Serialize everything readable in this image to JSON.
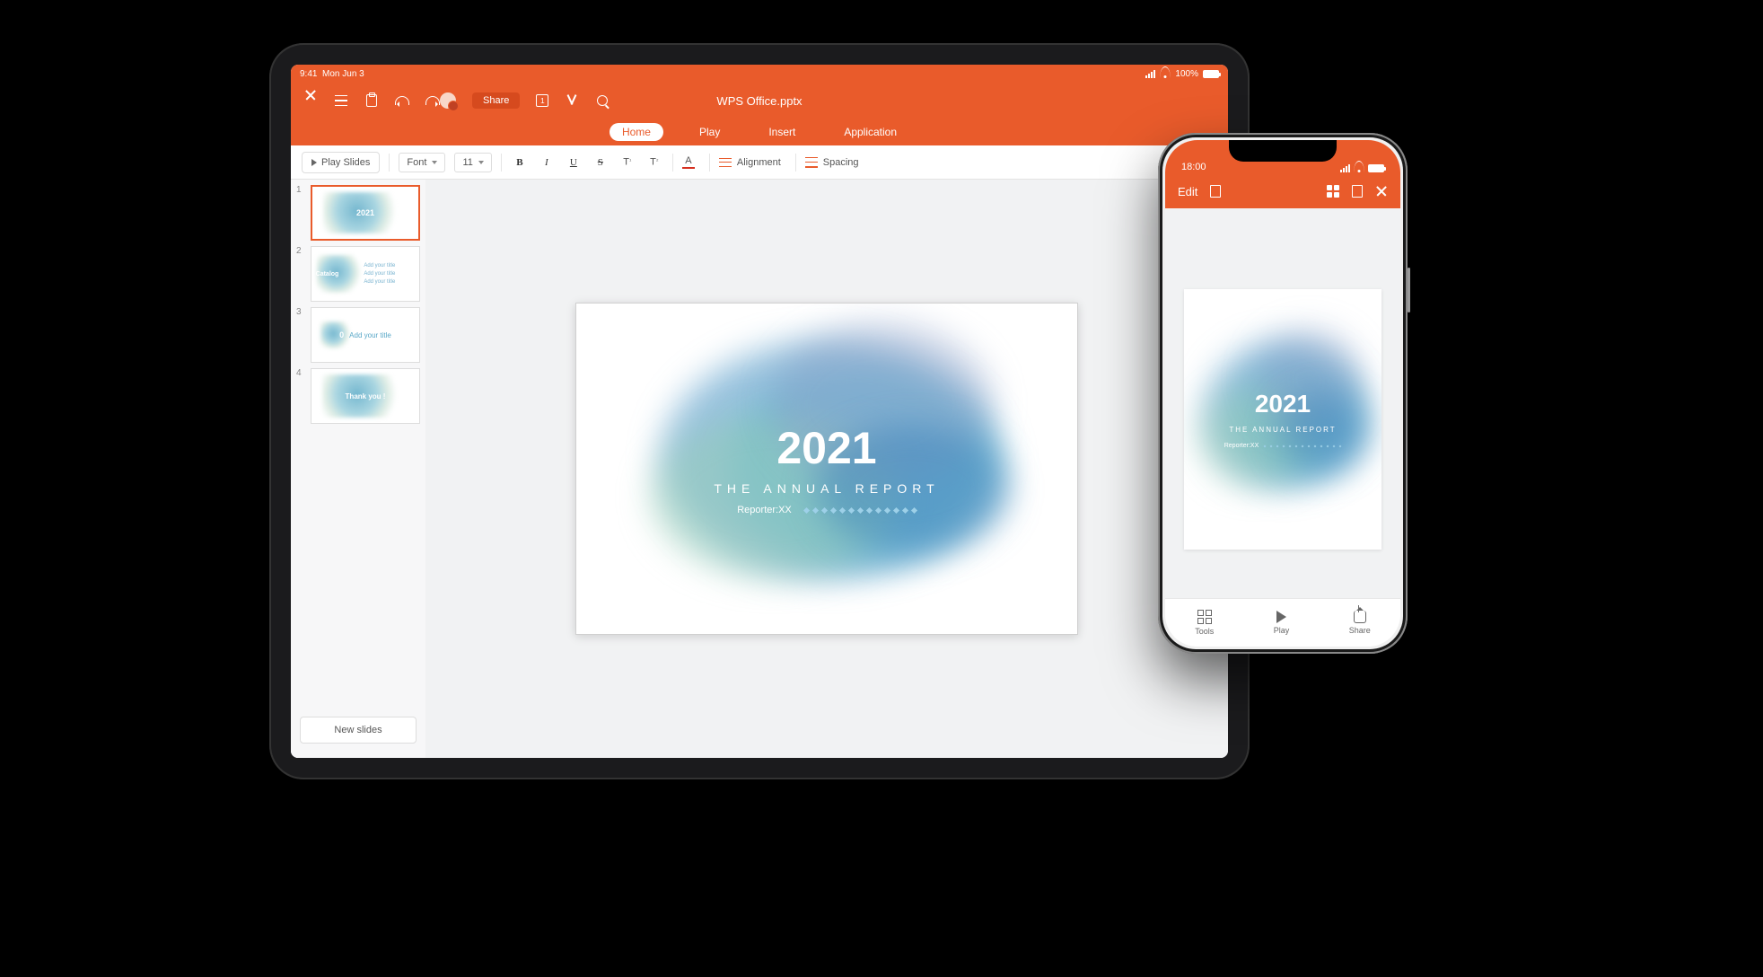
{
  "tablet": {
    "status": {
      "time": "9:41",
      "date": "Mon Jun 3",
      "battery": "100%"
    },
    "topbar": {
      "title": "WPS Office.pptx",
      "share": "Share",
      "page_indicator": "1"
    },
    "tabs": {
      "home": "Home",
      "play": "Play",
      "insert": "Insert",
      "application": "Application"
    },
    "toolbar": {
      "play_slides": "Play Slides",
      "font": "Font",
      "font_size": "11",
      "bold": "B",
      "italic": "I",
      "underline": "U",
      "strike": "S",
      "sup_a": "T",
      "sup_b": "T",
      "font_color_letter": "A",
      "alignment": "Alignment",
      "spacing": "Spacing"
    },
    "sidebar": {
      "nums": [
        "1",
        "2",
        "3",
        "4"
      ],
      "thumb1": "2021",
      "thumb2_label": "Catalog",
      "thumb2_item": "Add your title",
      "thumb3_num": "0",
      "thumb3_title": "Add your title",
      "thumb4": "Thank you !",
      "new_slides": "New slides"
    },
    "slide": {
      "year": "2021",
      "subtitle": "THE ANNUAL REPORT",
      "reporter": "Reporter:XX"
    }
  },
  "phone": {
    "status": {
      "time": "18:00"
    },
    "topbar": {
      "edit": "Edit"
    },
    "slide": {
      "year": "2021",
      "subtitle": "THE ANNUAL REPORT",
      "reporter": "Reporter:XX"
    },
    "bottombar": {
      "tools": "Tools",
      "play": "Play",
      "share": "Share"
    }
  }
}
